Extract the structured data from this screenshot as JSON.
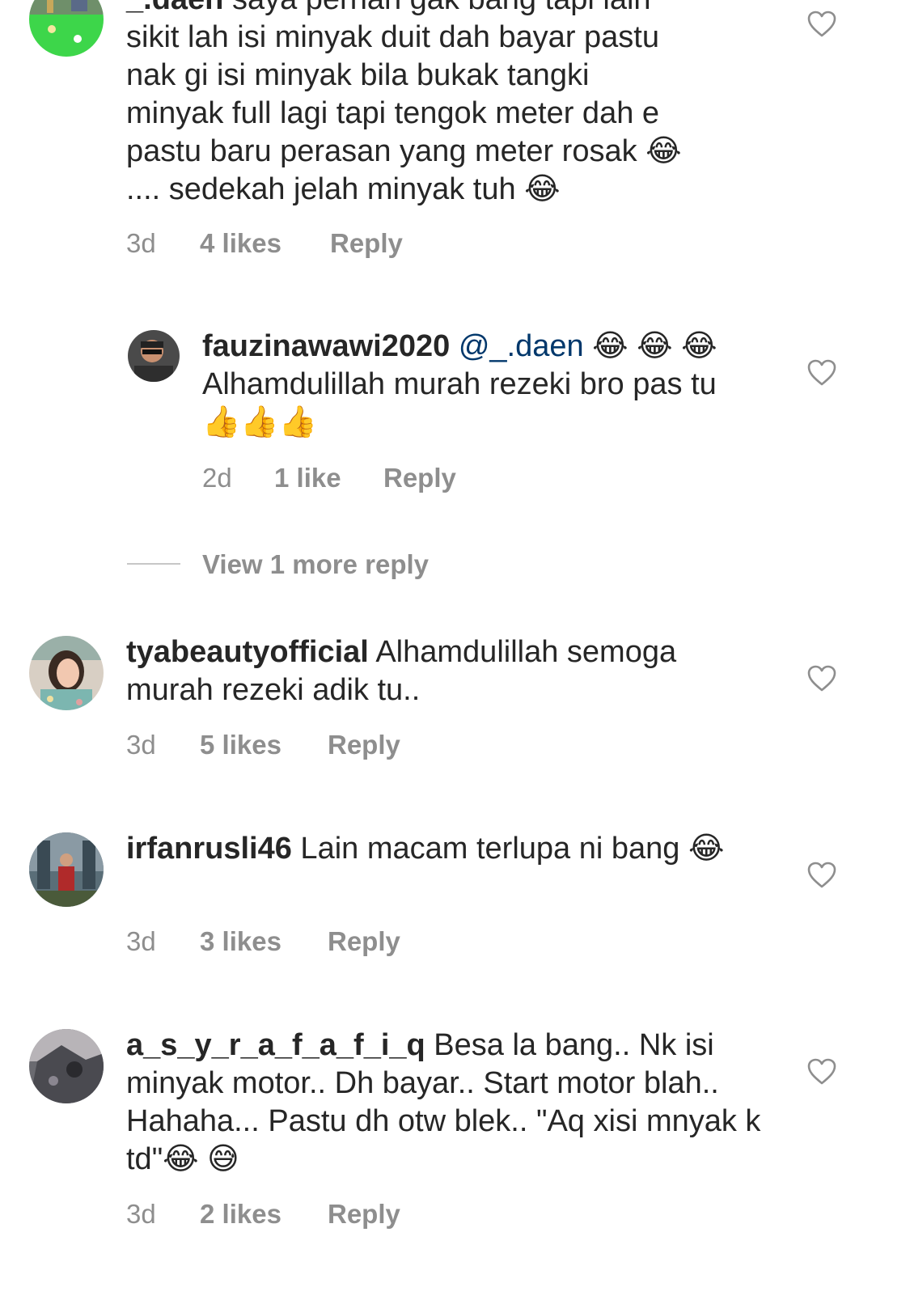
{
  "comments": [
    {
      "username": "_.daen",
      "lines": [
        "saya pernah gak bang tapi lain",
        "sikit lah isi minyak duit dah bayar pastu",
        "nak gi isi minyak bila bukak tangki",
        "minyak full lagi tapi tengok meter dah e",
        "pastu baru perasan yang meter rosak 😂",
        ".... sedekah jelah minyak tuh 😂"
      ],
      "time": "3d",
      "likes": "4 likes",
      "reply": "Reply"
    },
    {
      "username": "fauzinawawi2020",
      "mention": "@_.daen",
      "text_after_mention": " 😂 😂 😂 Alhamdulillah murah rezeki bro pas tu 👍👍👍",
      "time": "2d",
      "likes": "1 like",
      "reply": "Reply"
    },
    {
      "username": "tyabeautyofficial",
      "text": " Alhamdulillah semoga murah rezeki adik tu..",
      "time": "3d",
      "likes": "5 likes",
      "reply": "Reply"
    },
    {
      "username": "irfanrusli46",
      "text": " Lain macam terlupa ni bang 😂",
      "time": "3d",
      "likes": "3 likes",
      "reply": "Reply"
    },
    {
      "username": "a_s_y_r_a_f_a_f_i_q",
      "text": " Besa la bang.. Nk isi minyak motor.. Dh bayar.. Start motor blah.. Hahaha... Pastu dh otw blek.. \"Aq xisi mnyak k td\"😂 😅",
      "time": "3d",
      "likes": "2 likes",
      "reply": "Reply"
    }
  ],
  "view_more_replies": "View 1 more reply",
  "colors": {
    "text": "#262626",
    "meta": "#8e8e8e",
    "mention": "#00376b",
    "divider": "#c7c7c7"
  },
  "icons": {
    "like": "heart-outline-icon"
  }
}
